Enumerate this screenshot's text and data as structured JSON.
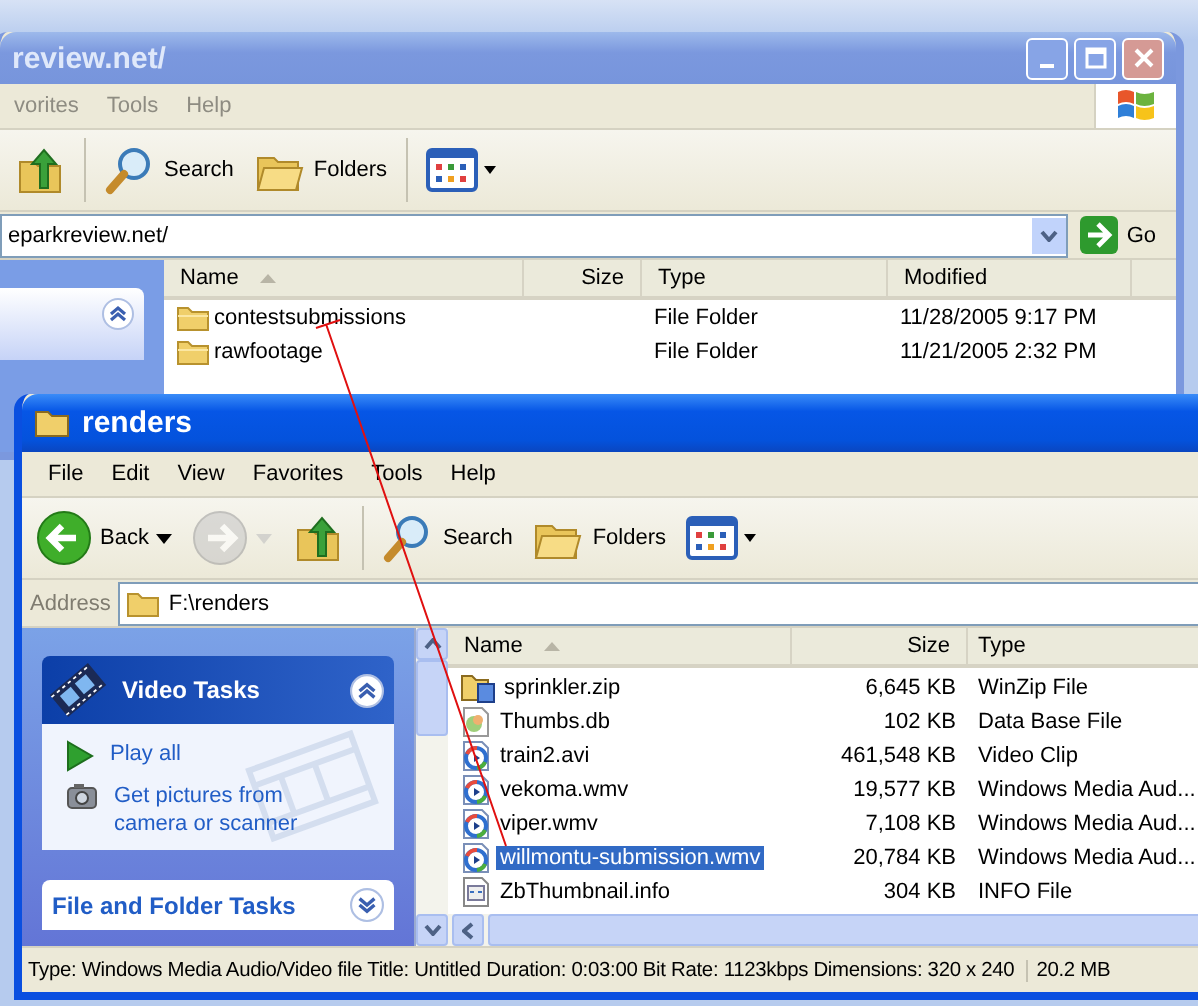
{
  "back_window": {
    "title": "review.net/",
    "active": false,
    "menu": [
      "vorites",
      "Tools",
      "Help"
    ],
    "toolbar": [
      {
        "kind": "up",
        "disabled": false
      },
      {
        "kind": "search",
        "label": "Search",
        "disabled": false
      },
      {
        "kind": "folders",
        "label": "Folders",
        "disabled": false
      },
      {
        "kind": "views",
        "disabled": false
      }
    ],
    "address": "eparkreview.net/",
    "go": "Go",
    "columns": [
      "Name",
      "Size",
      "Type",
      "Modified"
    ],
    "rows": [
      {
        "name": "contestsubmissions",
        "type": "File Folder",
        "modified": "11/28/2005 9:17 PM"
      },
      {
        "name": "rawfootage",
        "type": "File Folder",
        "modified": "11/21/2005 2:32 PM"
      }
    ]
  },
  "front_window": {
    "title": "renders",
    "active": true,
    "menu": [
      "File",
      "Edit",
      "View",
      "Favorites",
      "Tools",
      "Help"
    ],
    "toolbar": [
      {
        "kind": "back",
        "label": "Back",
        "disabled": false
      },
      {
        "kind": "forward",
        "disabled": true
      },
      {
        "kind": "up",
        "disabled": false
      },
      {
        "kind": "search",
        "label": "Search",
        "disabled": false
      },
      {
        "kind": "folders",
        "label": "Folders",
        "disabled": false
      },
      {
        "kind": "views",
        "disabled": false
      }
    ],
    "address_label": "Address",
    "address": "F:\\renders",
    "panels": [
      {
        "title": "Video Tasks",
        "expanded": true,
        "tasks": [
          {
            "kind": "play",
            "label": "Play all"
          },
          {
            "kind": "camera",
            "label": "Get pictures from camera or scanner"
          }
        ]
      },
      {
        "title": "File and Folder Tasks",
        "expanded": false
      }
    ],
    "columns": [
      "Name",
      "Size",
      "Type"
    ],
    "rows": [
      {
        "kind": "zip",
        "name": "sprinkler.zip",
        "size": "6,645 KB",
        "type": "WinZip File",
        "selected": false
      },
      {
        "kind": "db",
        "name": "Thumbs.db",
        "size": "102 KB",
        "type": "Data Base File",
        "selected": false
      },
      {
        "kind": "video",
        "name": "train2.avi",
        "size": "461,548 KB",
        "type": "Video Clip",
        "selected": false
      },
      {
        "kind": "video",
        "name": "vekoma.wmv",
        "size": "19,577 KB",
        "type": "Windows Media Aud...",
        "selected": false
      },
      {
        "kind": "video",
        "name": "viper.wmv",
        "size": "7,108 KB",
        "type": "Windows Media Aud...",
        "selected": false
      },
      {
        "kind": "video",
        "name": "willmontu-submission.wmv",
        "size": "20,784 KB",
        "type": "Windows Media Aud...",
        "selected": true
      },
      {
        "kind": "info",
        "name": "ZbThumbnail.info",
        "size": "304 KB",
        "type": "INFO File",
        "selected": false
      }
    ],
    "status": "Type: Windows Media Audio/Video file Title: Untitled Duration: 0:03:00 Bit Rate: 1123kbps Dimensions: 320 x 240",
    "status_size": "20.2 MB"
  }
}
